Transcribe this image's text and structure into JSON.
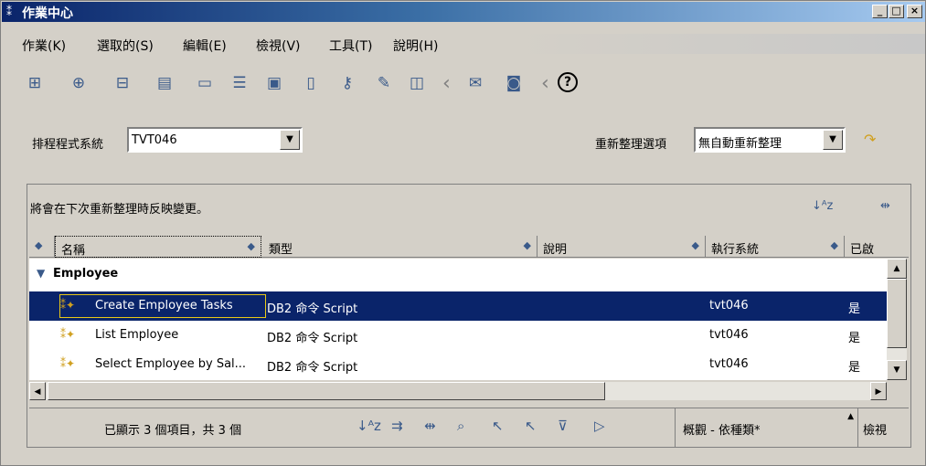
{
  "window": {
    "title": "作業中心",
    "buttons": [
      "_",
      "□",
      "×"
    ]
  },
  "menu": [
    "作業(K)",
    "選取的(S)",
    "編輯(E)",
    "檢視(V)",
    "工具(T)",
    "說明(H)"
  ],
  "toolbar": {
    "help_label": "?"
  },
  "scheduler": {
    "label": "排程程式系統",
    "value": "TVT046"
  },
  "refresh": {
    "label": "重新整理選項",
    "value": "無自動重新整理"
  },
  "panel": {
    "message": "將會在下次重新整理時反映變更。",
    "columns": [
      "名稱",
      "類型",
      "說明",
      "執行系統",
      "已啟"
    ],
    "group": "Employee",
    "rows": [
      {
        "name": "Create Employee Tasks",
        "type": "DB2 命令 Script",
        "desc": "",
        "system": "tvt046",
        "enabled": "是"
      },
      {
        "name": "List Employee",
        "type": "DB2 命令 Script",
        "desc": "",
        "system": "tvt046",
        "enabled": "是"
      },
      {
        "name": "Select Employee by Sal...",
        "type": "DB2 命令 Script",
        "desc": "",
        "system": "tvt046",
        "enabled": "是"
      }
    ]
  },
  "status": {
    "text": "已顯示 3 個項目，共 3 個",
    "view_select": "概觀 - 依種類*",
    "view_button": "檢視"
  }
}
